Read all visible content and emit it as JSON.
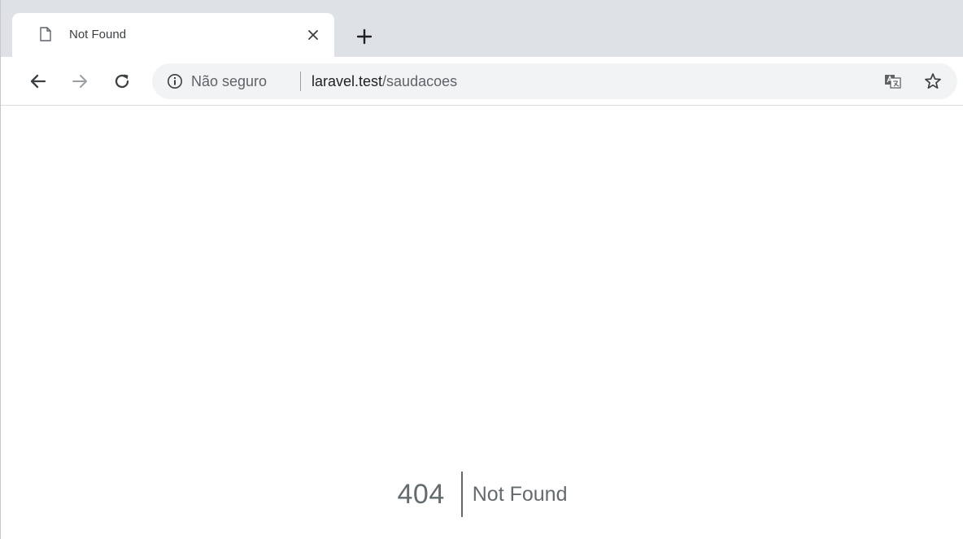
{
  "browser": {
    "tab": {
      "title": "Not Found",
      "icon": "document-icon",
      "close_icon": "close-icon"
    },
    "new_tab_icon": "plus-icon",
    "toolbar": {
      "back_icon": "arrow-left-icon",
      "forward_icon": "arrow-right-icon",
      "reload_icon": "reload-icon"
    },
    "omnibox": {
      "security_icon": "info-icon",
      "security_text": "Não seguro",
      "url_host": "laravel.test",
      "url_path": "/saudacoes",
      "translate_icon": "translate-icon",
      "bookmark_icon": "star-icon"
    },
    "colors": {
      "tabstrip": "#dee1e6",
      "omnibox": "#f1f3f4",
      "text": "#636b6f"
    }
  },
  "page": {
    "error_code": "404",
    "error_message": "Not Found"
  }
}
